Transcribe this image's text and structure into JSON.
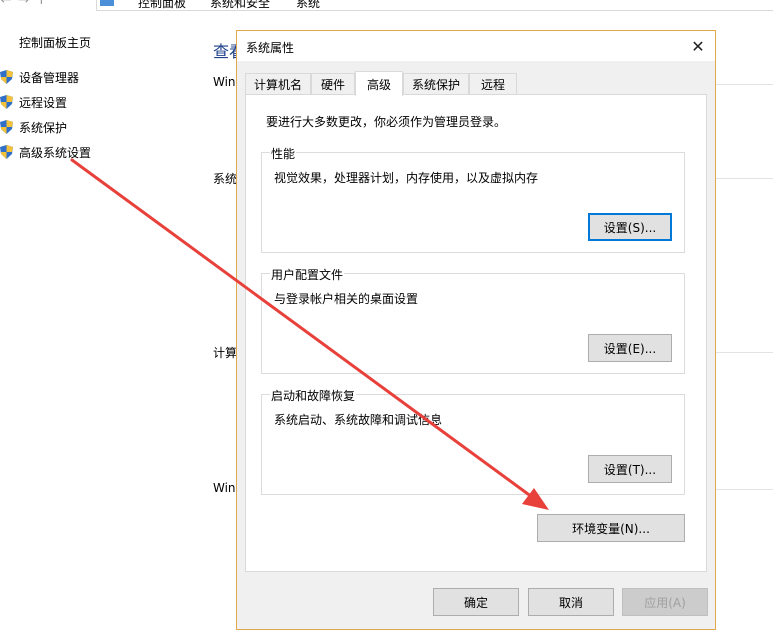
{
  "background_window": {
    "breadcrumb": [
      "控制面板",
      "系统和安全",
      "系统"
    ],
    "left_nav": {
      "home": "控制面板主页",
      "items": [
        {
          "label": "设备管理器",
          "icon": "shield-icon"
        },
        {
          "label": "远程设置",
          "icon": "shield-icon"
        },
        {
          "label": "系统保护",
          "icon": "shield-icon"
        },
        {
          "label": "高级系统设置",
          "icon": "shield-icon"
        }
      ]
    },
    "main_title": "查看",
    "fragments": [
      "Win",
      "系统",
      "计算",
      "Win"
    ]
  },
  "dialog": {
    "title": "系统属性",
    "close_label": "✕",
    "tabs": [
      {
        "label": "计算机名",
        "active": false
      },
      {
        "label": "硬件",
        "active": false
      },
      {
        "label": "高级",
        "active": true
      },
      {
        "label": "系统保护",
        "active": false
      },
      {
        "label": "远程",
        "active": false
      }
    ],
    "notice": "要进行大多数更改，你必须作为管理员登录。",
    "groups": [
      {
        "title": "性能",
        "description": "视觉效果，处理器计划，内存使用，以及虚拟内存",
        "button": "设置(S)..."
      },
      {
        "title": "用户配置文件",
        "description": "与登录帐户相关的桌面设置",
        "button": "设置(E)..."
      },
      {
        "title": "启动和故障恢复",
        "description": "系统启动、系统故障和调试信息",
        "button": "设置(T)..."
      }
    ],
    "env_button": "环境变量(N)...",
    "footer": {
      "ok": "确定",
      "cancel": "取消",
      "apply": "应用(A)"
    }
  },
  "colors": {
    "accent": "#0078d7",
    "dialog_border": "#e1a84e",
    "annotation_arrow": "#e8403a",
    "shield_blue": "#2f6fc9",
    "shield_yellow": "#f3c23a"
  }
}
